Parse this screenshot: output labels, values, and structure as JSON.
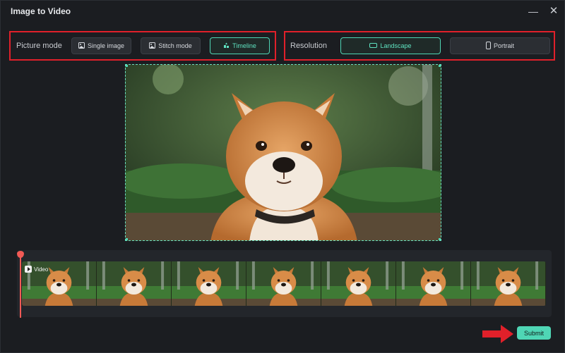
{
  "window": {
    "title": "Image to Video"
  },
  "picture_mode": {
    "label": "Picture mode",
    "options": [
      {
        "label": "Single image",
        "icon": "image-icon"
      },
      {
        "label": "Stitch mode",
        "icon": "image-icon"
      },
      {
        "label": "Timeline",
        "icon": "timeline-icon",
        "selected": true
      }
    ]
  },
  "resolution": {
    "label": "Resolution",
    "options": [
      {
        "label": "Landscape",
        "icon": "landscape-icon",
        "selected": true
      },
      {
        "label": "Portrait",
        "icon": "portrait-icon"
      }
    ]
  },
  "timeline": {
    "clip_label": "Video",
    "frame_count": 7
  },
  "footer": {
    "submit_label": "Submit"
  },
  "colors": {
    "accent": "#4fd6b5",
    "highlight_box": "#e0202a",
    "playhead": "#f25a55",
    "arrow": "#e0202a"
  }
}
